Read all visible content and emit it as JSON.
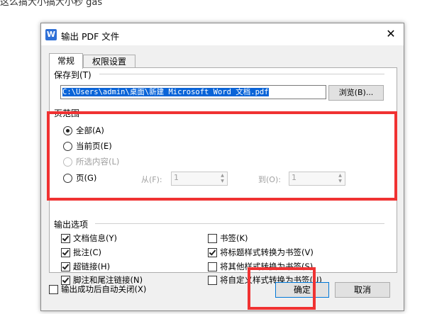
{
  "background_text": "这么搞大小搞大小秒 gas",
  "dialog": {
    "title": "输出 PDF 文件",
    "close_glyph": "✕",
    "tabs": [
      {
        "label": "常规",
        "active": true
      },
      {
        "label": "权限设置",
        "active": false
      }
    ],
    "save_to": {
      "label": "保存到(T)",
      "path": "C:\\Users\\admin\\桌面\\新建 Microsoft Word 文档.pdf",
      "browse_label": "浏览(B)..."
    },
    "page_range": {
      "label": "页范围",
      "options": [
        {
          "label": "全部(A)",
          "checked": true,
          "disabled": false
        },
        {
          "label": "当前页(E)",
          "checked": false,
          "disabled": false
        },
        {
          "label": "所选内容(L)",
          "checked": false,
          "disabled": true
        },
        {
          "label": "页(G)",
          "checked": false,
          "disabled": false
        }
      ],
      "from_label": "从(F):",
      "from_value": "1",
      "to_label": "到(O):",
      "to_value": "1"
    },
    "output_options": {
      "label": "输出选项",
      "left": [
        {
          "label": "文档信息(Y)",
          "checked": true
        },
        {
          "label": "批注(C)",
          "checked": true
        },
        {
          "label": "超链接(H)",
          "checked": true
        },
        {
          "label": "脚注和尾注链接(N)",
          "checked": true
        }
      ],
      "right": [
        {
          "label": "书签(K)",
          "checked": false
        },
        {
          "label": "将标题样式转换为书签(V)",
          "checked": true
        },
        {
          "label": "将其他样式转换为书签(S)",
          "checked": false
        },
        {
          "label": "将自定义样式转换为书签(U)",
          "checked": false
        }
      ]
    },
    "auto_close": {
      "label": "输出成功后自动关闭(X)",
      "checked": false
    },
    "ok_label": "确定",
    "cancel_label": "取消"
  },
  "colors": {
    "highlight": "#f03232",
    "selection": "#0a64d8",
    "app_icon": "#2e6fd6"
  }
}
